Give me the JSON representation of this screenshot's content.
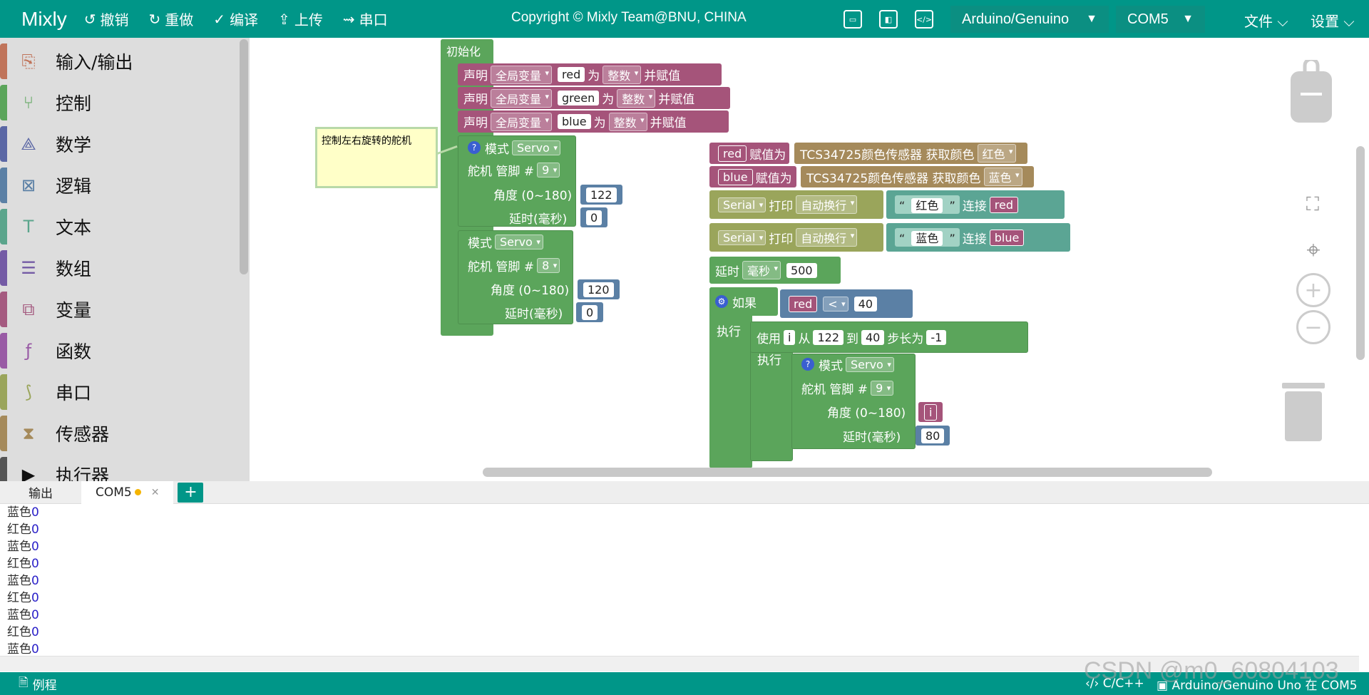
{
  "app": {
    "brand": "Mixly",
    "copyright": "Copyright © Mixly Team@BNU, CHINA"
  },
  "toolbar": {
    "undo": "撤销",
    "redo": "重做",
    "compile": "编译",
    "upload": "上传",
    "serial": "串口"
  },
  "board": {
    "label": "Arduino/Genuino"
  },
  "port": {
    "label": "COM5"
  },
  "menus": {
    "file": "文件",
    "settings": "设置"
  },
  "sidebar": {
    "items": [
      {
        "label": "输入/输出",
        "color": "#c0745a"
      },
      {
        "label": "控制",
        "color": "#5ba55b"
      },
      {
        "label": "数学",
        "color": "#5b67a5"
      },
      {
        "label": "逻辑",
        "color": "#5b80a5"
      },
      {
        "label": "文本",
        "color": "#5ba58c"
      },
      {
        "label": "数组",
        "color": "#745ba5"
      },
      {
        "label": "变量",
        "color": "#a55b80"
      },
      {
        "label": "函数",
        "color": "#995ba5"
      },
      {
        "label": "串口",
        "color": "#9aa55b"
      },
      {
        "label": "传感器",
        "color": "#a58a5b"
      },
      {
        "label": "执行器",
        "color": "#555555"
      }
    ]
  },
  "blocks": {
    "init": "初始化",
    "declare": "声明",
    "global_var": "全局变量",
    "as": "为",
    "int_type": "整数",
    "assign": "并赋值",
    "var_red": "red",
    "var_green": "green",
    "var_blue": "blue",
    "comment": "控制左右旋转的舵机",
    "mode": "模式",
    "servo": "Servo",
    "servo_pin": "舵机  管脚 #",
    "pin9": "9",
    "pin8": "8",
    "angle": "角度 (0~180)",
    "delay_ms": "延时(毫秒)",
    "angle1": "122",
    "delay1": "0",
    "angle2": "120",
    "delay2": "0",
    "assign_to": "赋值为",
    "tcs_get": "TCS34725颜色传感器 获取颜色",
    "color_red": "红色",
    "color_blue": "蓝色",
    "serial": "Serial",
    "print": "打印",
    "auto_newline": "自动换行",
    "str_red": "红色",
    "str_blue": "蓝色",
    "concat": "连接",
    "delay": "延时",
    "ms": "毫秒",
    "delay_val": "500",
    "if": "如果",
    "lt": "<",
    "cmp_val": "40",
    "do": "执行",
    "use": "使用",
    "loop_var": "i",
    "from": "从",
    "from_val": "122",
    "to": "到",
    "to_val": "40",
    "step": "步长为",
    "step_val": "-1",
    "loop_delay": "80"
  },
  "output": {
    "tab_output": "输出",
    "tab_com": "COM5",
    "add": "+",
    "lines": [
      {
        "text": "蓝色",
        "num": "0"
      },
      {
        "text": "红色",
        "num": "0"
      },
      {
        "text": "蓝色",
        "num": "0"
      },
      {
        "text": "红色",
        "num": "0"
      },
      {
        "text": "蓝色",
        "num": "0"
      },
      {
        "text": "红色",
        "num": "0"
      },
      {
        "text": "蓝色",
        "num": "0"
      },
      {
        "text": "红色",
        "num": "0"
      },
      {
        "text": "蓝色",
        "num": "0"
      }
    ]
  },
  "footer": {
    "examples": "例程",
    "lang": "C/C++",
    "status": "Arduino/Genuino Uno 在 COM5"
  },
  "watermark": "CSDN @m0_60804103"
}
